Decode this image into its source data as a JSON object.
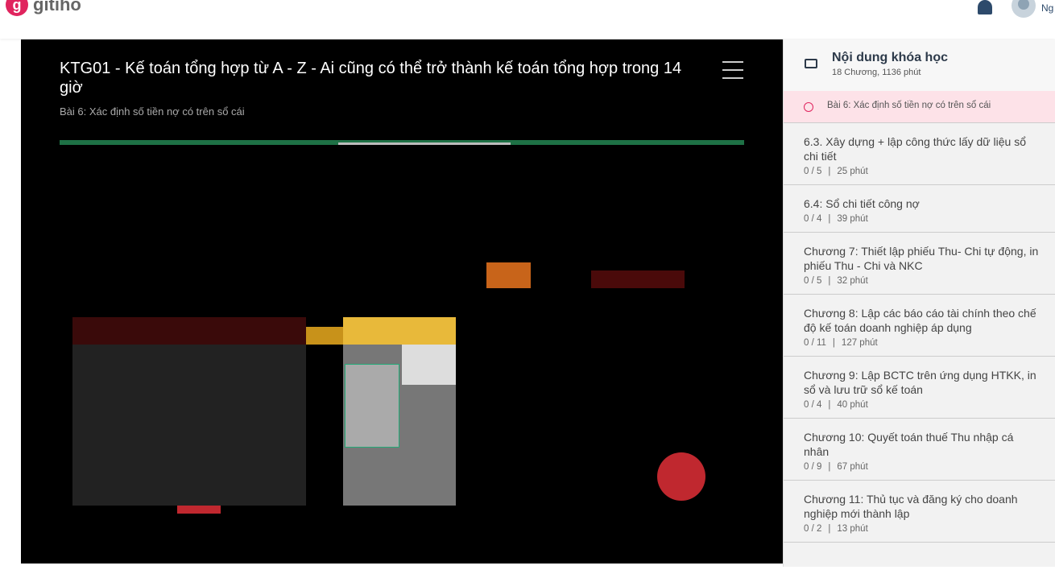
{
  "header": {
    "logo_text": "gitiho",
    "username": "Ng"
  },
  "player": {
    "title": "KTG01 - Kế toán tổng hợp từ A - Z - Ai cũng có thể trở thành kế toán tổng hợp trong 14 giờ",
    "lesson": "Bài 6: Xác định số tiền nợ có trên sổ cái"
  },
  "sidebar": {
    "title": "Nội dung khóa học",
    "summary": "18 Chương, 1136 phút",
    "current_lesson": "Bài 6: Xác định số tiền nợ có trên sổ cái",
    "items": [
      {
        "title": "6.3. Xây dựng + lập công thức lấy dữ liệu sổ chi tiết",
        "progress": "0 / 5",
        "duration": "25 phút"
      },
      {
        "title": "6.4: Sổ chi tiết công nợ",
        "progress": "0 / 4",
        "duration": "39 phút"
      },
      {
        "title": "Chương 7: Thiết lập phiếu Thu- Chi tự động, in phiếu Thu - Chi và NKC",
        "progress": "0 / 5",
        "duration": "32 phút"
      },
      {
        "title": "Chương 8: Lập các báo cáo tài chính theo chế độ kế toán doanh nghiệp áp dụng",
        "progress": "0 / 11",
        "duration": "127 phút"
      },
      {
        "title": "Chương 9: Lập BCTC trên ứng dụng HTKK, in sổ và lưu trữ sổ kế toán",
        "progress": "0 / 4",
        "duration": "40 phút"
      },
      {
        "title": "Chương 10: Quyết toán thuế Thu nhập cá nhân",
        "progress": "0 / 9",
        "duration": "67 phút"
      },
      {
        "title": "Chương 11: Thủ tục và đăng ký cho doanh nghiệp mới thành lập",
        "progress": "0 / 2",
        "duration": "13 phút"
      }
    ]
  }
}
